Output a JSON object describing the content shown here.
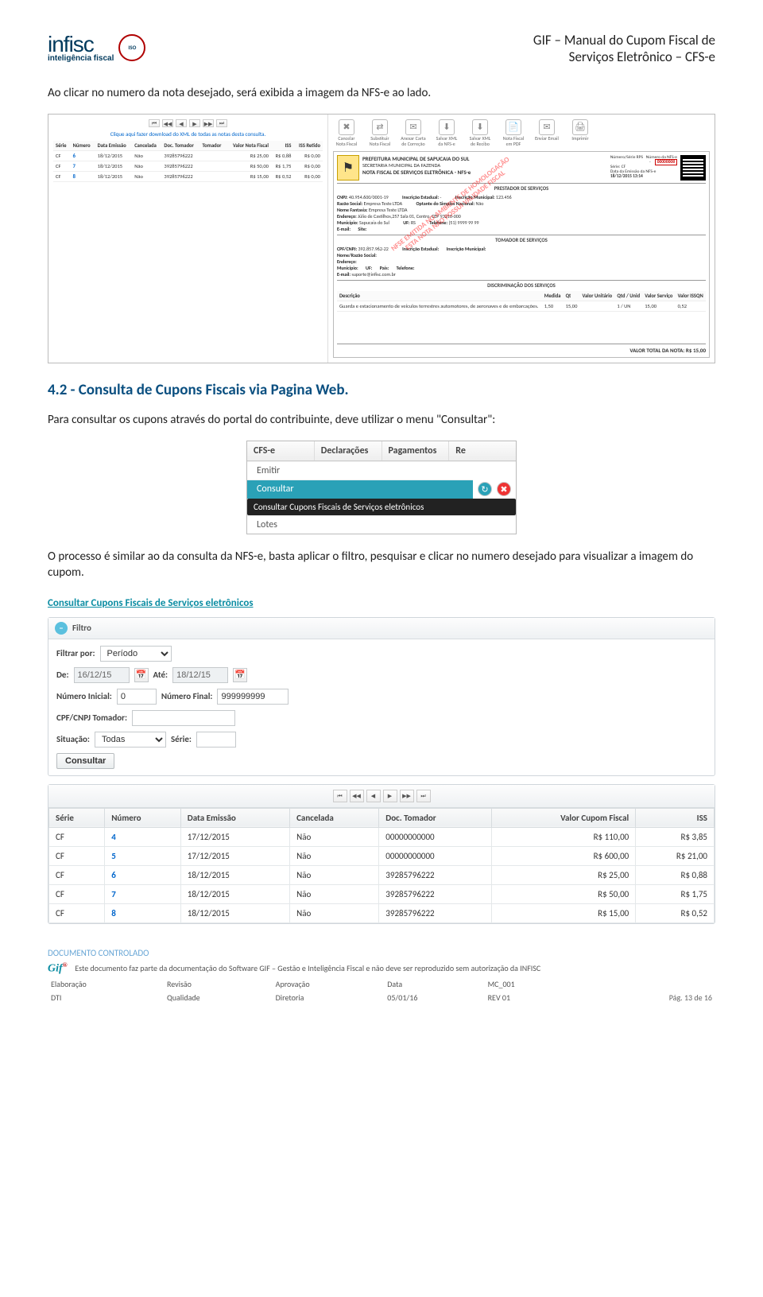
{
  "header": {
    "brand_name": "infisc",
    "brand_sub": "inteligência fiscal",
    "iso_label": "ISO",
    "doc_title_l1": "GIF – Manual do Cupom Fiscal de",
    "doc_title_l2": "Serviços Eletrônico – CFS-e"
  },
  "intro_text": "Ao clicar no numero da nota desejado, será exibida a imagem da NFS-e ao lado.",
  "nfse_list": {
    "pager_glyphs": [
      "⏮",
      "◀◀",
      "◀",
      "▶",
      "▶▶",
      "⏭"
    ],
    "download_link": "Clique aqui fazer download do XML de todas as notas desta consulta.",
    "columns": [
      "Série",
      "Número",
      "Data Emissão",
      "Cancelada",
      "Doc. Tomador",
      "Tomador",
      "Valor Nota Fiscal",
      "ISS",
      "ISS Retido"
    ],
    "rows": [
      {
        "serie": "CF",
        "numero": "6",
        "data": "18/12/2015",
        "canc": "Não",
        "doc": "39285796222",
        "tom": "",
        "valor": "R$ 25,00",
        "iss": "R$ 0,88",
        "ret": "R$ 0,00"
      },
      {
        "serie": "CF",
        "numero": "7",
        "data": "18/12/2015",
        "canc": "Não",
        "doc": "39285796222",
        "tom": "",
        "valor": "R$ 50,00",
        "iss": "R$ 1,75",
        "ret": "R$ 0,00"
      },
      {
        "serie": "CF",
        "numero": "8",
        "data": "18/12/2015",
        "canc": "Não",
        "doc": "39285796222",
        "tom": "",
        "valor": "R$ 15,00",
        "iss": "R$ 0,52",
        "ret": "R$ 0,00"
      }
    ]
  },
  "nfse_preview": {
    "actions": [
      {
        "glyph": "✖",
        "label": "Cancelar Nota Fiscal"
      },
      {
        "glyph": "⇄",
        "label": "Substituir Nota Fiscal"
      },
      {
        "glyph": "✉",
        "label": "Anexar Carta de Correção"
      },
      {
        "glyph": "⬇",
        "label": "Salvar XML da NFS-e"
      },
      {
        "glyph": "⬇",
        "label": "Salvar XML de Recibo"
      },
      {
        "glyph": "📄",
        "label": "Nota Fiscal em PDF"
      },
      {
        "glyph": "✉",
        "label": "Enviar Email"
      },
      {
        "glyph": "🖨",
        "label": "Imprimir"
      }
    ],
    "coat_glyph": "⚑",
    "line1": "PREFEITURA MUNICIPAL DE SAPUCAIA DO SUL",
    "line2": "SECRETARIA MUNICIPAL DA FAZENDA",
    "line3": "NOTA FISCAL DE SERVIÇOS ELETRÔNICA - NFS-e",
    "right_col": {
      "numero_serie": "Número/Série RPS",
      "numero": "Número da NFS-e",
      "numero_val": "00000008",
      "serie_label": "Série:",
      "serie": "CF",
      "data_label": "Data da Emissão da NFS-e",
      "data": "18/12/2015 13:14"
    },
    "prestador_title": "PRESTADOR DE SERVIÇOS",
    "prestador": {
      "cnpj_label": "CNPJ:",
      "cnpj": "40.954.600/0001-19",
      "ie_label": "Inscrição Estadual:",
      "ie": "-",
      "im_label": "Inscrição Municipal:",
      "im": "123.456",
      "razao_label": "Razão Social:",
      "razao": "Empresa Teste LTDA",
      "simples_label": "Optante do Simples Nacional:",
      "simples": "Não",
      "fantasia_label": "Nome Fantasia:",
      "fantasia": "Empresa Teste LTDA",
      "endereco_label": "Endereço:",
      "endereco": "Júlio de Castilhos,257 Sala 01, Centro, CEP 93210-000",
      "municipio_label": "Município:",
      "municipio": "Sapucaia do Sul",
      "uf_label": "UF:",
      "uf": "RS",
      "tel_label": "Telefone:",
      "tel": "(51) 9999 99 99",
      "site_label": "Site:",
      "email_label": "E-mail:"
    },
    "tomador_title": "TOMADOR DE SERVIÇOS",
    "tomador": {
      "cpf_label": "CPF/CNPJ:",
      "cpf": "392.857.962-22",
      "ie_label": "Inscrição Estadual:",
      "im_label": "Inscrição Municipal:",
      "razao_label": "Nome/Razão Social:",
      "endereco_label": "Endereço:",
      "municipio_label": "Município:",
      "uf_label": "UF:",
      "pais_label": "País:",
      "tel_label": "Telefone:",
      "email_label": "E-mail:",
      "email": "suporte@infisc.com.br"
    },
    "servicos_title": "DISCRIMINAÇÃO DOS SERVIÇOS",
    "servicos_cols": [
      "Descrição",
      "Medida",
      "Qt",
      "Valor Unitário",
      "Qtd / Unid",
      "Valor Serviço",
      "Valor ISSQN"
    ],
    "servico_row": {
      "desc": "Guarda e estacionamento de veículos terrestres automotores, de aeronaves e de embarcações.",
      "medida": "1,50",
      "qt": "15,00",
      "vu": "",
      "unid": "1 / UN",
      "vs": "15,00",
      "viss": "0,52"
    },
    "valor_total": "VALOR TOTAL DA NOTA: R$ 15,00",
    "stamp_l1": "NFSE EMITIDA NO AMBIENTE DE HOMOLOGAÇÃO",
    "stamp_l2": "ESTA NOTA NÃO POSSUI VALIDADE FISCAL"
  },
  "heading_4_2": "4.2 - Consulta de Cupons Fiscais via Pagina Web.",
  "para_consultar": "Para consultar os cupons através do portal do contribuinte, deve utilizar o  menu \"Consultar\":",
  "menu": {
    "tabs": [
      "CFS-e",
      "Declarações",
      "Pagamentos",
      "Re"
    ],
    "items": [
      "Emitir",
      "Consultar",
      "Lotes"
    ],
    "active_tooltip": "Consultar Cupons Fiscais de Serviços eletrônicos"
  },
  "processo_text": "O processo é similar ao da consulta da NFS-e, basta aplicar o filtro, pesquisar e clicar no numero desejado para visualizar a imagem do cupom.",
  "filter_panel": {
    "title": "Consultar Cupons Fiscais de Serviços eletrônicos",
    "filtro_label": "Filtro",
    "filtrar_por_label": "Filtrar por:",
    "filtrar_por_value": "Período",
    "de_label": "De:",
    "de_value": "16/12/15",
    "ate_label": "Até:",
    "ate_value": "18/12/15",
    "num_ini_label": "Número Inicial:",
    "num_ini_value": "0",
    "num_fin_label": "Número Final:",
    "num_fin_value": "999999999",
    "cpf_label": "CPF/CNPJ Tomador:",
    "cpf_value": "",
    "sit_label": "Situação:",
    "sit_value": "Todas",
    "serie_label": "Série:",
    "serie_value": "",
    "consultar_btn": "Consultar"
  },
  "results": {
    "pager_glyphs": [
      "⏮",
      "◀◀",
      "◀",
      "▶",
      "▶▶",
      "⏭"
    ],
    "columns": [
      "Série",
      "Número",
      "Data Emissão",
      "Cancelada",
      "Doc. Tomador",
      "Valor Cupom Fiscal",
      "ISS"
    ],
    "rows": [
      {
        "serie": "CF",
        "numero": "4",
        "data": "17/12/2015",
        "canc": "Não",
        "doc": "00000000000",
        "valor": "R$ 110,00",
        "iss": "R$ 3,85"
      },
      {
        "serie": "CF",
        "numero": "5",
        "data": "17/12/2015",
        "canc": "Não",
        "doc": "00000000000",
        "valor": "R$ 600,00",
        "iss": "R$ 21,00"
      },
      {
        "serie": "CF",
        "numero": "6",
        "data": "18/12/2015",
        "canc": "Não",
        "doc": "39285796222",
        "valor": "R$ 25,00",
        "iss": "R$ 0,88"
      },
      {
        "serie": "CF",
        "numero": "7",
        "data": "18/12/2015",
        "canc": "Não",
        "doc": "39285796222",
        "valor": "R$ 50,00",
        "iss": "R$ 1,75"
      },
      {
        "serie": "CF",
        "numero": "8",
        "data": "18/12/2015",
        "canc": "Não",
        "doc": "39285796222",
        "valor": "R$ 15,00",
        "iss": "R$ 0,52"
      }
    ]
  },
  "footer": {
    "controlled": "DOCUMENTO CONTROLADO",
    "gif": "Gif",
    "disclaimer": "Este documento faz parte da documentação do Software GIF – Gestão e Inteligência Fiscal e não deve ser reproduzido sem autorização da INFISC",
    "labels": {
      "elab": "Elaboração",
      "rev": "Revisão",
      "aprov": "Aprovação",
      "data": "Data",
      "code": "MC_001"
    },
    "values": {
      "elab": "DTI",
      "rev": "Qualidade",
      "aprov": "Diretoria",
      "data": "05/01/16",
      "code": "REV 01"
    },
    "page": "Pág. 13 de 16"
  }
}
